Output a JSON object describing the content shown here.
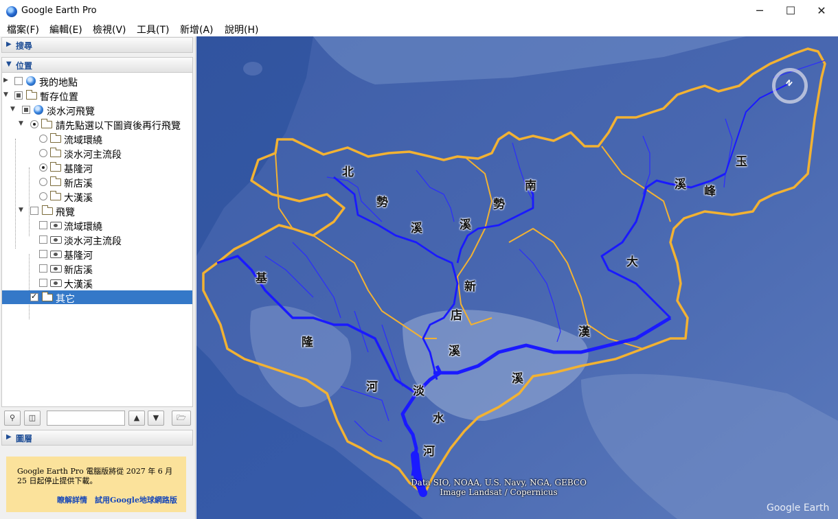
{
  "window": {
    "title": "Google Earth Pro",
    "minimize": "─",
    "maximize": "☐",
    "close": "✕"
  },
  "menu": [
    "檔案(F)",
    "編輯(E)",
    "檢視(V)",
    "工具(T)",
    "新增(A)",
    "說明(H)"
  ],
  "sidebar": {
    "search_header": "搜尋",
    "places_header": "位置",
    "layers_header": "圖層",
    "tree": {
      "my_places": "我的地點",
      "temporary_places": "暫存位置",
      "tamsui_flyover": "淡水河飛覽",
      "select_first": "請先點選以下圖資後再行飛覽",
      "radio_items": [
        "流域環繞",
        "淡水河主流段",
        "基隆河",
        "新店溪",
        "大漢溪"
      ],
      "radio_selected": "基隆河",
      "tour_folder": "飛覽",
      "tour_items": [
        "流域環繞",
        "淡水河主流段",
        "基隆河",
        "新店溪",
        "大漢溪"
      ],
      "other": "其它"
    }
  },
  "notice": {
    "text": "Google Earth Pro 電腦版將從 2027 年 6 月 25 日起停止提供下載。",
    "link_learn": "瞭解詳情",
    "link_try": "試用Google地球網路版"
  },
  "map": {
    "labels": [
      {
        "text": "北",
        "name": "label-bei"
      },
      {
        "text": "勢",
        "name": "label-shi-1"
      },
      {
        "text": "溪",
        "name": "label-xi-1"
      },
      {
        "text": "溪",
        "name": "label-xi-2"
      },
      {
        "text": "勢",
        "name": "label-shi-2"
      },
      {
        "text": "南",
        "name": "label-nan"
      },
      {
        "text": "玉",
        "name": "label-yu"
      },
      {
        "text": "溪",
        "name": "label-xi-3"
      },
      {
        "text": "峰",
        "name": "label-feng"
      },
      {
        "text": "大",
        "name": "label-da"
      },
      {
        "text": "新",
        "name": "label-xin"
      },
      {
        "text": "店",
        "name": "label-dian"
      },
      {
        "text": "溪",
        "name": "label-xi-4"
      },
      {
        "text": "漢",
        "name": "label-han"
      },
      {
        "text": "溪",
        "name": "label-xi-5"
      },
      {
        "text": "基",
        "name": "label-ji"
      },
      {
        "text": "隆",
        "name": "label-long"
      },
      {
        "text": "河",
        "name": "label-he-1"
      },
      {
        "text": "淡",
        "name": "label-dan"
      },
      {
        "text": "水",
        "name": "label-shui"
      },
      {
        "text": "河",
        "name": "label-he-2"
      }
    ],
    "credits_line1": "Data SIO, NOAA, U.S. Navy, NGA, GEBCO",
    "credits_line2": "Image Landsat / Copernicus",
    "watermark": "Google Earth",
    "compass_letter": "N"
  },
  "colors": {
    "boundary": "#f2b233",
    "river": "#1a1aff",
    "selection": "#3478c8",
    "notice_bg": "#fbe29b"
  }
}
